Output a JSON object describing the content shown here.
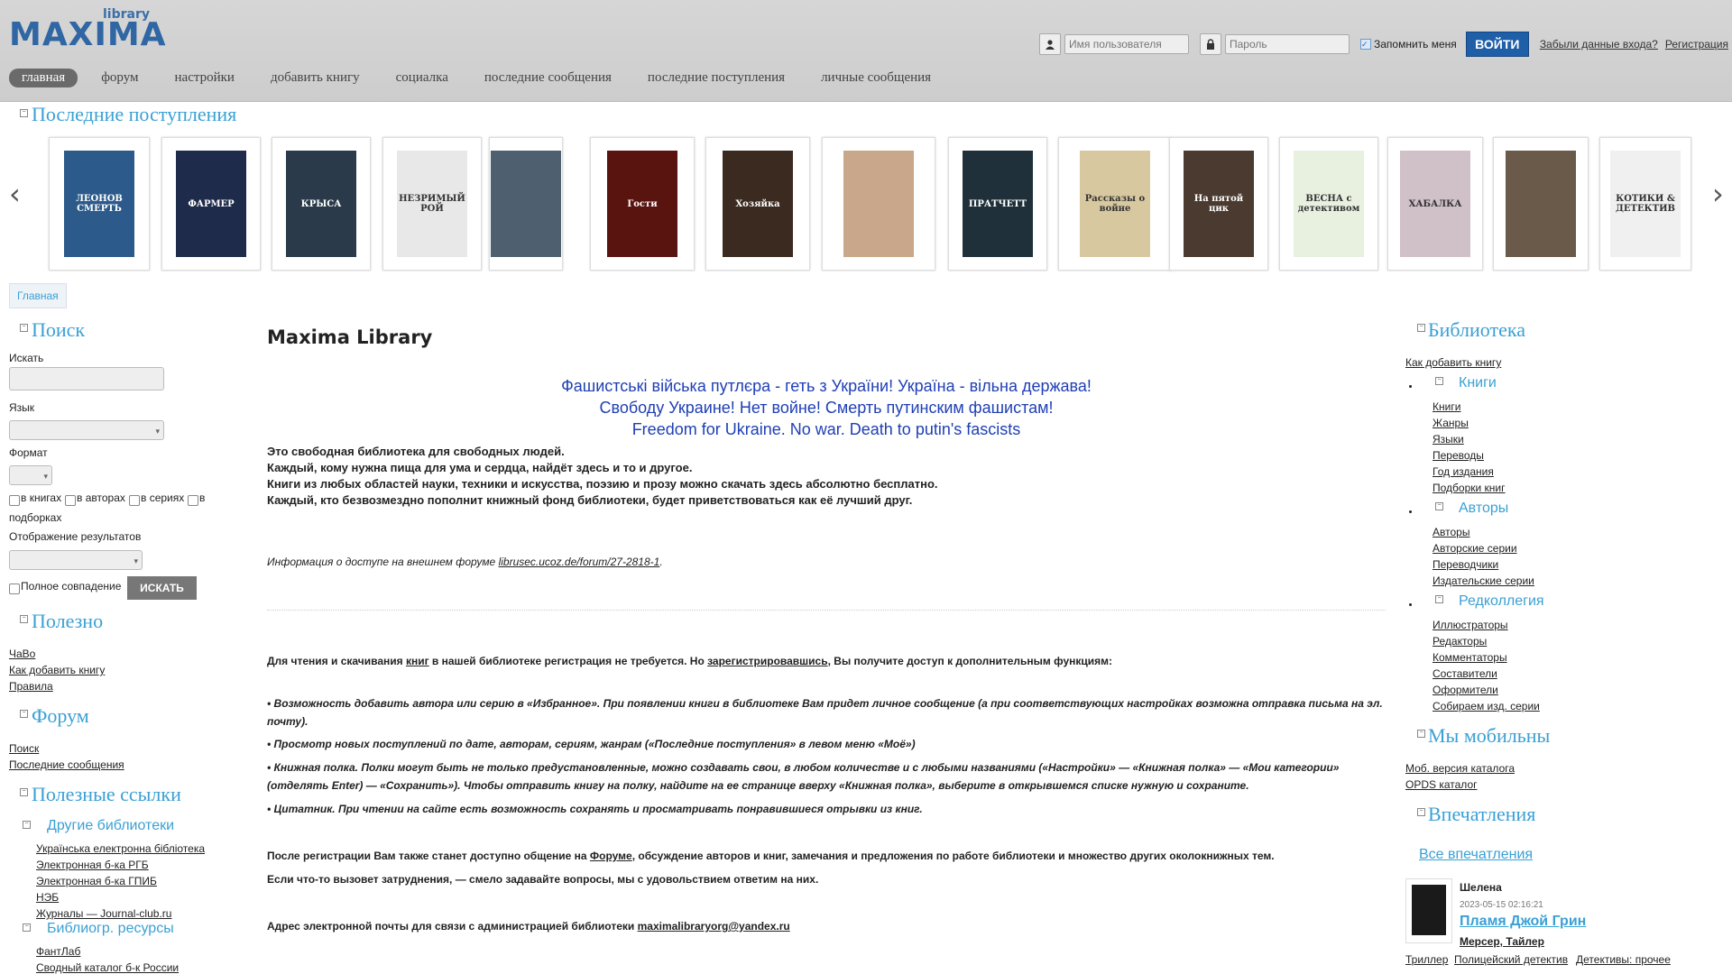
{
  "header": {
    "logo_word": "MAXIMA",
    "logo_small": "library",
    "login": {
      "user_placeholder": "Имя пользователя",
      "pass_placeholder": "Пароль",
      "remember_label": "Запомнить меня",
      "login_button": "ВОЙТИ",
      "forgot_link": "Забыли данные входа?",
      "register_link": "Регистрация"
    },
    "nav": [
      "главная",
      "форум",
      "настройки",
      "добавить книгу",
      "социалка",
      "последние сообщения",
      "последние поступления",
      "личные сообщения"
    ]
  },
  "recent": {
    "title": "Последние поступления",
    "books": [
      {
        "text": "ЛЕОНОВ СМЕРТЬ",
        "color": "#2c5a8a"
      },
      {
        "text": "ФАРМЕР",
        "color": "#1e2b4a"
      },
      {
        "text": "КРЫСА",
        "color": "#2a3a4a"
      },
      {
        "text": "НЕЗРИМЫЙ РОЙ",
        "color": "#e8e8e8"
      },
      {
        "text": "",
        "color": "#4e6070"
      },
      {
        "text": "Гости",
        "color": "#5a1410"
      },
      {
        "text": "Хозяйка",
        "color": "#3a2a20"
      },
      {
        "text": "",
        "color": "#c8a78a"
      },
      {
        "text": "ПРАТЧЕТТ",
        "color": "#20303a"
      },
      {
        "text": "Рассказы о войне",
        "color": "#d8c8a0"
      },
      {
        "text": "На пятой цик",
        "color": "#4a3a30"
      },
      {
        "text": "ВЕСНА с детективом",
        "color": "#e8f0e0"
      },
      {
        "text": "ХАБАЛКА",
        "color": "#d0c0c8"
      },
      {
        "text": "",
        "color": "#6a5a4a"
      },
      {
        "text": "КОТИКИ & ДЕТЕКТИВ",
        "color": "#f0f0f0"
      }
    ]
  },
  "breadcrumb": "Главная",
  "left": {
    "search": {
      "title": "Поиск",
      "find_label": "Искать",
      "lang_label": "Язык",
      "format_label": "Формат",
      "cb_books": "в книгах",
      "cb_authors": "в авторах",
      "cb_series": "в сериях",
      "cb_sel": "в",
      "cb_sel2": "подборках",
      "display_label": "Отображение результатов",
      "exact_label": "Полное совпадение",
      "search_button": "ИСКАТЬ"
    },
    "useful": {
      "title": "Полезно",
      "links": [
        "ЧаВо",
        "Как добавить книгу",
        "Правила"
      ]
    },
    "forum": {
      "title": "Форум",
      "links": [
        "Поиск",
        "Последние сообщения"
      ]
    },
    "links": {
      "title": "Полезные ссылки",
      "other_title": "Другие библиотеки",
      "other": [
        "Українська електронна бібліотека",
        "Электронная б-ка РГБ",
        "Электронная б-ка ГПИБ",
        "НЭБ",
        "Журналы — Journal-club.ru"
      ],
      "biblio_title": "Библиогр. ресурсы",
      "biblio": [
        "ФантЛаб",
        "Сводный каталог б-к России"
      ]
    }
  },
  "main": {
    "title": "Maxima Library",
    "slogans": [
      "Фашистські війська путлєра - геть з України! Україна - вільна держава!",
      "Свободу Украине! Нет войне! Смерть путинским фашистам!",
      "Freedom for Ukraine. No war. Death to putin's fascists"
    ],
    "intro": [
      "Это свободная библиотека для свободных людей.",
      "Каждый, кому нужна пища для ума и сердца, найдёт здесь и то и другое.",
      "Книги из любых областей науки, техники и искусства, поэзию и прозу можно скачать здесь абсолютно бесплатно.",
      "Каждый, кто безвозмездно пополнит книжный фонд библиотеки, будет приветствоваться как её лучший друг."
    ],
    "forum_info_pre": "Информация о доступе на внешнем форуме ",
    "forum_info_link": "librusec.ucoz.de/forum/27-2818-1",
    "reg_pre": "Для чтения и скачивания ",
    "reg_link1": "книг",
    "reg_mid": " в нашей библиотеке регистрация не требуется. Но ",
    "reg_link2": "зарегистрировавшись",
    "reg_post": ", Вы получите доступ к дополнительным функциям:",
    "bullets": [
      "•  Возможность добавить автора или серию в «Избранное». При появлении книги в библиотеке Вам придет личное сообщение (а при соответствующих настройках возможна отправка письма на эл. почту).",
      "•  Просмотр новых поступлений по дате, авторам, сериям, жанрам («Последние поступления» в левом меню «Моё»)",
      "•  Книжная полка. Полки могут быть не только предустановленные, можно создавать свои, в любом количестве и с любыми названиями («Настройки» — «Книжная полка» — «Мои категории» (отделять Enter) — «Сохранить»). Чтобы отправить книгу на полку, найдите на ее странице вверху «Книжная полка», выберите в открывшемся списке нужную и сохраните.",
      "•  Цитатник. При чтении на сайте есть возможность сохранять и просматривать понравившиеся отрывки из книг."
    ],
    "after_pre": "После регистрации Вам также станет доступно общение на ",
    "after_link": "Форуме",
    "after_post": ", обсуждение авторов и книг, замечания и предложения по работе библиотеки и множество других околокнижных тем.",
    "trouble": "Если что-то вызовет затруднения, — смело задавайте вопросы, мы с удовольствием ответим на них.",
    "email_pre": "Адрес электронной почты для связи с администрацией библиотеки ",
    "email": "maximalibraryorg@yandex.ru"
  },
  "right": {
    "library_title": "Библиотека",
    "how_add": "Как добавить книгу",
    "books_title": "Книги",
    "books": [
      "Книги",
      "Жанры",
      "Языки",
      "Переводы",
      "Год издания",
      "Подборки книг"
    ],
    "authors_title": "Авторы",
    "authors": [
      "Авторы",
      "Авторские серии",
      "Переводчики",
      "Издательские серии"
    ],
    "editorial_title": "Редколлегия",
    "editorial": [
      "Иллюстраторы",
      "Редакторы",
      "Комментаторы",
      "Составители",
      "Оформители",
      "Собираем изд. серии"
    ],
    "mobile_title": "Мы мобильны",
    "mobile": [
      "Моб. версия каталога",
      "OPDS каталог"
    ],
    "impressions_title": "Впечатления",
    "all_impressions": "Все впечатления",
    "imp_user": "Шелена",
    "imp_date": "2023-05-15 02:16:21",
    "imp_book": "Пламя Джой Грин",
    "imp_author": "Мерсер, Тайлер",
    "imp_tags": [
      "Триллер",
      "Полицейский детектив",
      "Детективы: прочее"
    ]
  }
}
